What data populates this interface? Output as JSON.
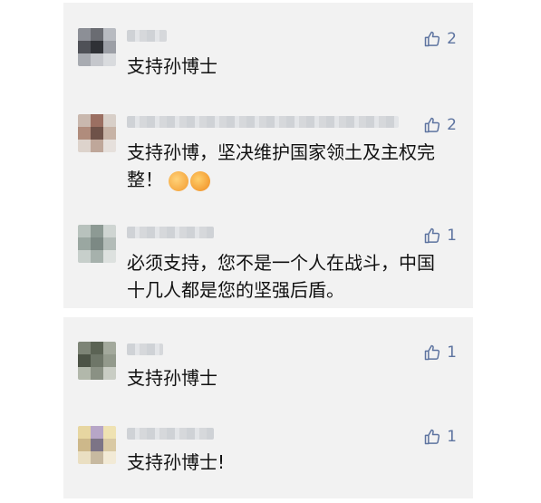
{
  "comments": [
    {
      "text": "支持孙博士",
      "likes": "2"
    },
    {
      "text": "支持孙博，坚决维护国家领土及主权完",
      "text2": "整！",
      "likes": "2",
      "emojis": [
        "thumbs-up-emoji",
        "fist-emoji"
      ]
    },
    {
      "text": "必须支持，您不是一个人在战斗，中国",
      "text2": "十几人都是您的坚强后盾。",
      "likes": "1"
    },
    {
      "text": "支持孙博士",
      "likes": "1"
    },
    {
      "text": "支持孙博士!",
      "likes": "1"
    }
  ],
  "colors": {
    "panel": "#f2f2f2",
    "like": "#5e74a0",
    "text": "#111111"
  },
  "icons": {
    "like": "thumbs-up-outline-icon"
  }
}
